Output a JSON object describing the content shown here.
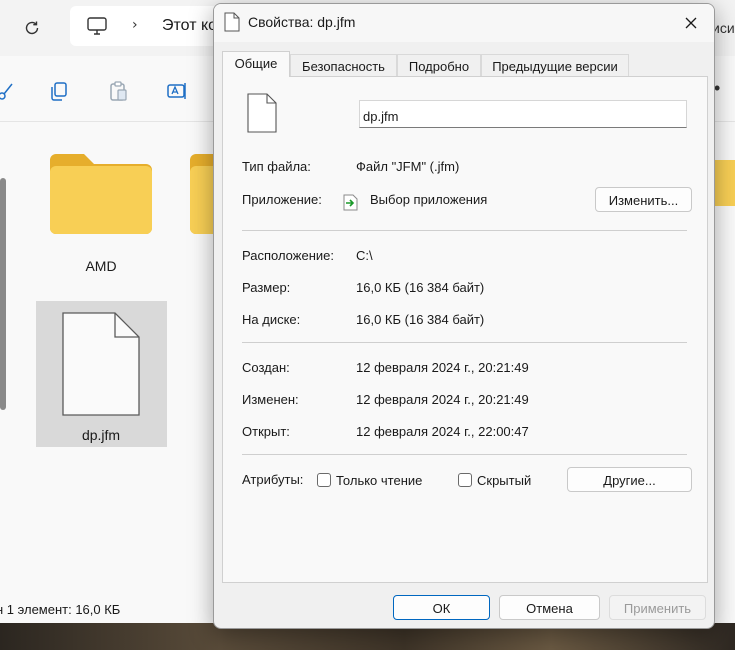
{
  "explorer": {
    "breadcrumb_text": "Этот ко",
    "search_fragment": "иси",
    "items": [
      {
        "label": "AMD"
      },
      {
        "label": "dp.jfm"
      }
    ],
    "status": "1 элемент: 16,0 КБ",
    "status_visible": "н 1 элемент: 16,0 КБ"
  },
  "dialog": {
    "title": "Свойства: dp.jfm",
    "tabs": [
      {
        "label": "Общие",
        "active": true
      },
      {
        "label": "Безопасность",
        "active": false
      },
      {
        "label": "Подробно",
        "active": false
      },
      {
        "label": "Предыдущие версии",
        "active": false
      }
    ],
    "file_name": "dp.jfm",
    "fields": {
      "type_label": "Тип файла:",
      "type_value": "Файл \"JFM\" (.jfm)",
      "app_label": "Приложение:",
      "app_value": "Выбор приложения",
      "change_button": "Изменить...",
      "location_label": "Расположение:",
      "location_value": "C:\\",
      "size_label": "Размер:",
      "size_value": "16,0 КБ (16 384 байт)",
      "disk_label": "На диске:",
      "disk_value": "16,0 КБ (16 384 байт)",
      "created_label": "Создан:",
      "created_value": "12 февраля 2024 г., 20:21:49",
      "modified_label": "Изменен:",
      "modified_value": "12 февраля 2024 г., 20:21:49",
      "accessed_label": "Открыт:",
      "accessed_value": "12 февраля 2024 г., 22:00:47",
      "attributes_label": "Атрибуты:",
      "readonly_label": "Только чтение",
      "readonly_checked": false,
      "hidden_label": "Скрытый",
      "hidden_checked": false,
      "other_button": "Другие..."
    },
    "buttons": {
      "ok": "ОК",
      "cancel": "Отмена",
      "apply": "Применить"
    }
  },
  "colors": {
    "accent": "#0067c0",
    "folder": "#f5c443",
    "dialog_bg": "#f0f0f0"
  }
}
